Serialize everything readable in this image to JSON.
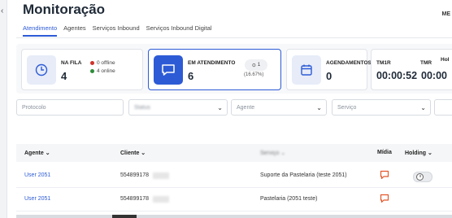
{
  "page": {
    "title": "Monitoração",
    "right_clip_text": "ME"
  },
  "tabs": [
    {
      "label": "Atendimento",
      "active": true
    },
    {
      "label": "Agentes",
      "active": false
    },
    {
      "label": "Serviços Inbound",
      "active": false
    },
    {
      "label": "Serviços Inbound Digital",
      "active": false
    }
  ],
  "cards": {
    "queue": {
      "label": "NA FILA",
      "value": "4",
      "offline": "0 offline",
      "online": "4 online"
    },
    "in_service": {
      "label": "EM ATENDIMENTO",
      "value": "6",
      "badge": "1",
      "percent": "(16.67%)"
    },
    "scheduled": {
      "label": "AGENDAMENTOS",
      "value": "0"
    },
    "times": {
      "tm1_label": "TM1R",
      "tm1_value": "00:00:52",
      "tm2_label": "TMR",
      "tm2_value": "00:00",
      "clip_label": "Hol"
    }
  },
  "filters": {
    "protocol_placeholder": "Protocolo",
    "status_placeholder": "Status",
    "agent_placeholder": "Agente",
    "service_placeholder": "Serviço"
  },
  "table": {
    "headers": {
      "agent": "Agente",
      "client": "Cliente",
      "service": "Serviço",
      "media": "Mídia",
      "holding": "Holding"
    },
    "rows": [
      {
        "agent": "User 2051",
        "client": "554899178",
        "service": "Suporte da Pastelaria (teste 2051)"
      },
      {
        "agent": "User 2051",
        "client": "554899178",
        "service": "Pastelaria (2051 teste)"
      }
    ]
  },
  "colors": {
    "accent": "#2d5bd6",
    "offline": "#d0332b",
    "online": "#2e8b3a",
    "media_icon": "#e3572b"
  }
}
